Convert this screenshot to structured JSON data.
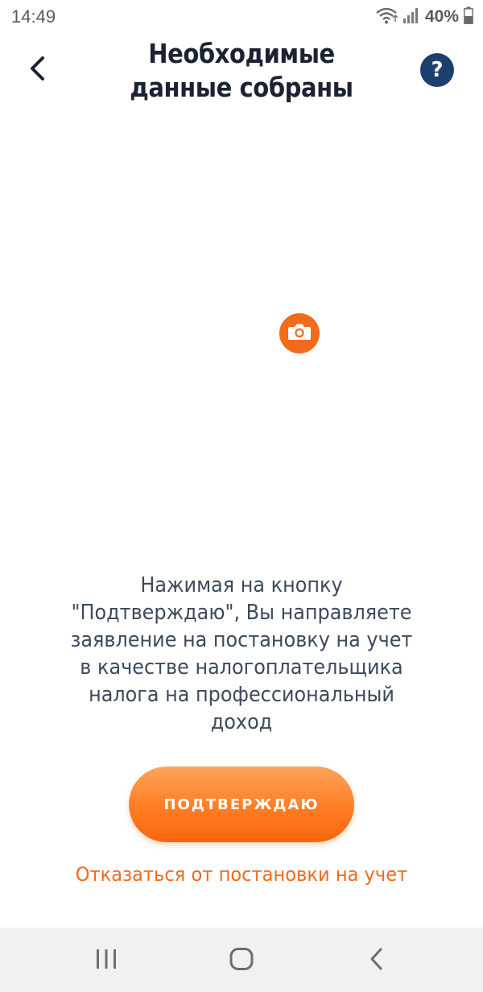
{
  "status_bar": {
    "time": "14:49",
    "battery": "40%",
    "icons": [
      "wifi-icon",
      "signal-icon",
      "battery-icon"
    ]
  },
  "header": {
    "title_line1": "Необходимые",
    "title_line2": "данные собраны",
    "back_icon": "chevron-left-icon",
    "help_label": "?"
  },
  "camera": {
    "icon": "camera-icon",
    "color": "#f26a1b"
  },
  "consent": {
    "lines": [
      "Нажимая на кнопку",
      "\"Подтверждаю\", Вы направляете",
      "заявление на постановку на учет",
      "в качестве налогоплательщика",
      "налога на профессиональный",
      "доход"
    ]
  },
  "actions": {
    "confirm_label": "ПОДТВЕРЖДАЮ",
    "decline_label": "Отказаться от постановки на учет"
  },
  "nav_bar": {
    "items": [
      "recent-apps-icon",
      "home-icon",
      "back-icon"
    ]
  },
  "colors": {
    "accent": "#f26a1b",
    "title": "#1b2333",
    "help_bg": "#1d3f70",
    "body_text": "#3c4a5c"
  }
}
